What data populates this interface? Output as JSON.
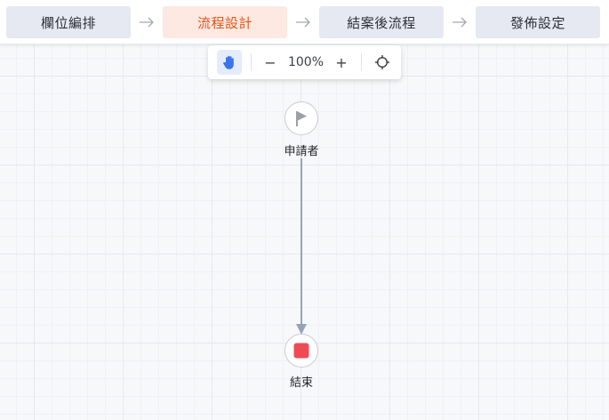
{
  "steps": [
    {
      "label": "欄位編排",
      "active": false
    },
    {
      "label": "流程設計",
      "active": true
    },
    {
      "label": "結案後流程",
      "active": false
    },
    {
      "label": "發佈設定",
      "active": false
    }
  ],
  "toolbar": {
    "hand_icon": "hand-icon",
    "zoom_out_label": "−",
    "zoom_level": "100%",
    "zoom_in_label": "+",
    "center_icon": "crosshair-icon"
  },
  "flow": {
    "start_node": {
      "label": "申請者",
      "icon": "flag-icon"
    },
    "end_node": {
      "label": "結束",
      "icon": "stop-icon"
    }
  },
  "colors": {
    "active_step_bg": "#fde9e1",
    "active_step_text": "#e2541c",
    "step_bg": "#e6e9f2",
    "hand_active": "#3c73e9",
    "connector": "#9aa3b5",
    "end_stop": "#f04b55"
  }
}
